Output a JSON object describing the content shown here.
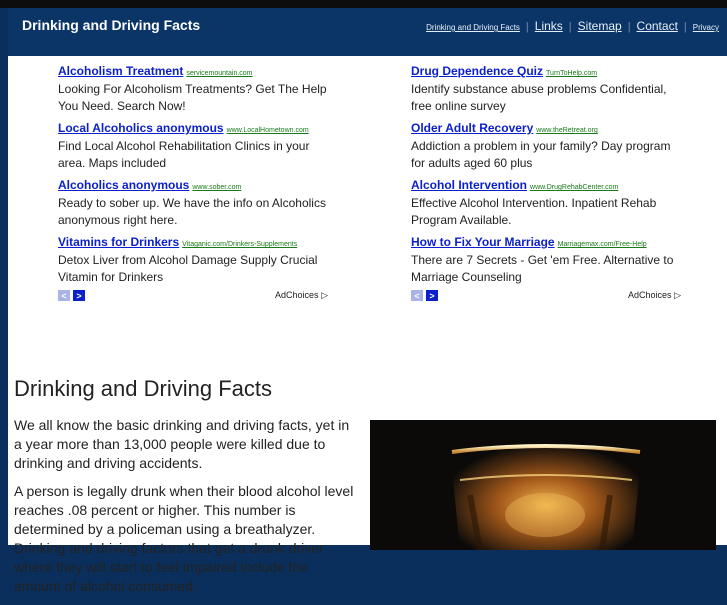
{
  "header": {
    "site_title": "Drinking and Driving Facts",
    "nav": {
      "current": "Drinking and Driving Facts",
      "links": "Links",
      "sitemap": "Sitemap",
      "contact": "Contact",
      "privacy": "Privacy"
    }
  },
  "ads": {
    "left": [
      {
        "title": "Alcoholism Treatment",
        "url": "servicemountain.com",
        "desc": "Looking For Alcoholism Treatments? Get The Help You Need. Search Now!"
      },
      {
        "title": "Local Alcoholics anonymous",
        "url": "www.LocalHometown.com",
        "desc": "Find Local Alcohol Rehabilitation Clinics in your area. Maps included"
      },
      {
        "title": "Alcoholics anonymous",
        "url": "www.sober.com",
        "desc": "Ready to sober up. We have the info on Alcoholics anonymous right here."
      },
      {
        "title": "Vitamins for Drinkers",
        "url": "Vitaganic.com/Drinkers-Supplements",
        "desc": "Detox Liver from Alcohol Damage Supply Crucial Vitamin for Drinkers"
      }
    ],
    "right": [
      {
        "title": "Drug Dependence Quiz",
        "url": "TurnToHelp.com",
        "desc": "Identify substance abuse problems Confidential, free online survey"
      },
      {
        "title": "Older Adult Recovery",
        "url": "www.theRetreat.org",
        "desc": "Addiction a problem in your family? Day program for adults aged 60 plus"
      },
      {
        "title": "Alcohol Intervention",
        "url": "www.DrugRehabCenter.com",
        "desc": "Effective Alcohol Intervention. Inpatient Rehab Program Available."
      },
      {
        "title": "How to Fix Your Marriage",
        "url": "Marriagemax.com/Free-Help",
        "desc": "There are 7 Secrets - Get 'em Free. Alternative to Marriage Counseling"
      }
    ],
    "adchoices": "AdChoices",
    "prev_glyph": "<",
    "next_glyph": ">"
  },
  "article": {
    "heading": "Drinking and Driving Facts",
    "paragraphs": [
      "We all know the basic drinking and driving facts, yet in a year more than 13,000 people were killed due to drinking and driving accidents.",
      "A person is legally drunk when their blood alcohol level reaches .08 percent or higher. This number is determined by a policeman using a breathalyzer. Drinking and driving factors that get a drunk driver where they will start to feel impaired include the amount of alcohol consumed."
    ]
  }
}
